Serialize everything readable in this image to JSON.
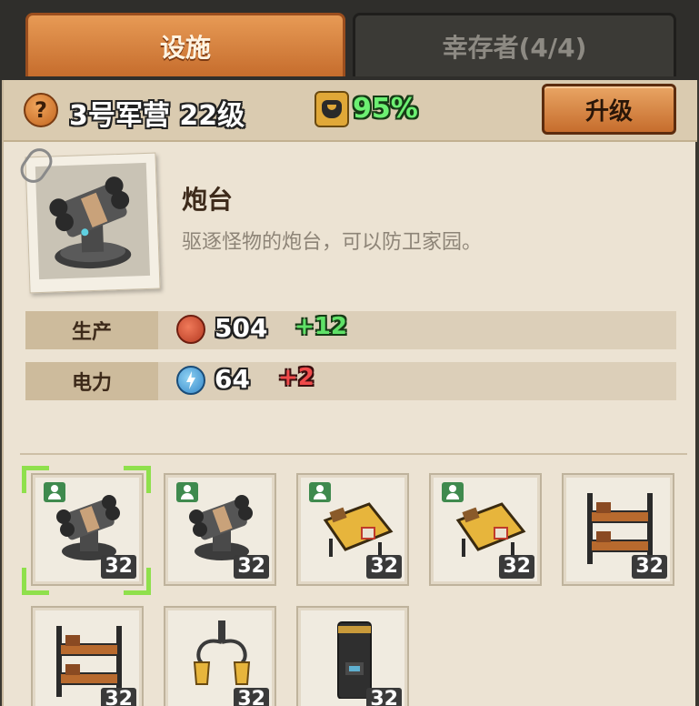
{
  "tabs": [
    {
      "label": "设施",
      "active": true
    },
    {
      "label": "幸存者(4/4)",
      "active": false
    }
  ],
  "info": {
    "help_icon": "?",
    "building_name": "3号军营 22级",
    "happiness_icon": "happiness-mask-icon",
    "happiness": "95%",
    "upgrade_label": "升级"
  },
  "building": {
    "title": "炮台",
    "description": "驱逐怪物的炮台，可以防卫家园。"
  },
  "stats": [
    {
      "label": "生产",
      "icon": "bottlecap-icon",
      "value": "504",
      "bonus": "+12",
      "bonus_color": "#5fe167"
    },
    {
      "label": "电力",
      "icon": "lightning-icon",
      "value": "64",
      "bonus": "+2",
      "bonus_color": "#f04a4a"
    }
  ],
  "slots": [
    {
      "item": "turret",
      "level": "32",
      "worker": true,
      "selected": true
    },
    {
      "item": "turret",
      "level": "32",
      "worker": true,
      "selected": false
    },
    {
      "item": "sleeping-mat",
      "level": "32",
      "worker": true,
      "selected": false
    },
    {
      "item": "sleeping-mat",
      "level": "32",
      "worker": true,
      "selected": false
    },
    {
      "item": "bunk-bed",
      "level": "32",
      "worker": false,
      "selected": false
    },
    {
      "item": "bunk-bed",
      "level": "32",
      "worker": false,
      "selected": false
    },
    {
      "item": "lantern-post",
      "level": "32",
      "worker": false,
      "selected": false
    },
    {
      "item": "cabinet",
      "level": "32",
      "worker": false,
      "selected": false
    }
  ]
}
